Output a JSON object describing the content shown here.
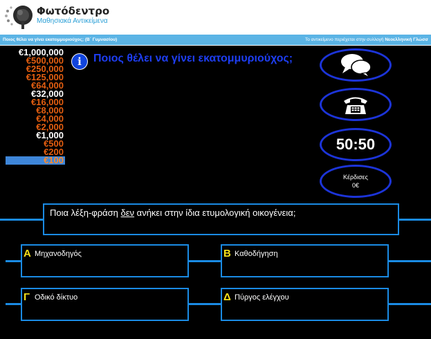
{
  "header": {
    "brand_title": "Φωτόδεντρο",
    "brand_subtitle": "Μαθησιακά Αντικείμενα",
    "logo_icon": "photodentro-tree-logo"
  },
  "strip": {
    "left_text": "Ποιος θέλει να γίνει εκατομμυριούχος; (Β΄ Γυμνασίου)",
    "right_text": "Το αντικείμενο περιέχεται στην συλλογή",
    "right_collection": "Νεοελληνική Γλώσσ"
  },
  "game": {
    "title": "Ποιος θέλει να γίνει εκατομμυριούχος;",
    "info_label": "i",
    "ladder": [
      {
        "label": "€1,000,000",
        "style": "white"
      },
      {
        "label": "€500,000",
        "style": "orange"
      },
      {
        "label": "€250,000",
        "style": "orange"
      },
      {
        "label": "€125,000",
        "style": "orange"
      },
      {
        "label": "€64,000",
        "style": "orange"
      },
      {
        "label": "€32,000",
        "style": "white"
      },
      {
        "label": "€16,000",
        "style": "orange"
      },
      {
        "label": "€8,000",
        "style": "orange"
      },
      {
        "label": "€4,000",
        "style": "orange"
      },
      {
        "label": "€2,000",
        "style": "orange"
      },
      {
        "label": "€1,000",
        "style": "white"
      },
      {
        "label": "€500",
        "style": "orange"
      },
      {
        "label": "€200",
        "style": "orange"
      },
      {
        "label": "€100",
        "style": "current"
      }
    ],
    "lifelines": {
      "audience_icon": "speech-bubbles-icon",
      "phone_icon": "telephone-icon",
      "fifty_label": "50:50",
      "won_label": "Κέρδισες",
      "won_amount": "0€"
    },
    "question": {
      "before": "Ποια λέξη-φράση ",
      "underlined": "δεν",
      "after": " ανήκει στην ίδια ετυμολογική οικογένεια;"
    },
    "answers": [
      {
        "letter": "A",
        "text": "Μηχανοδηγός"
      },
      {
        "letter": "B",
        "text": "Καθοδήγηση"
      },
      {
        "letter": "Γ",
        "text": "Οδικό δίκτυο"
      },
      {
        "letter": "Δ",
        "text": "Πύργος ελέγχου"
      }
    ],
    "colors": {
      "accent_blue": "#1a8be4",
      "title_blue": "#1e3ef2",
      "prize_orange": "#e45e10",
      "letter_yellow": "#f6e11a",
      "current_level_bg": "#3e86d9"
    }
  }
}
